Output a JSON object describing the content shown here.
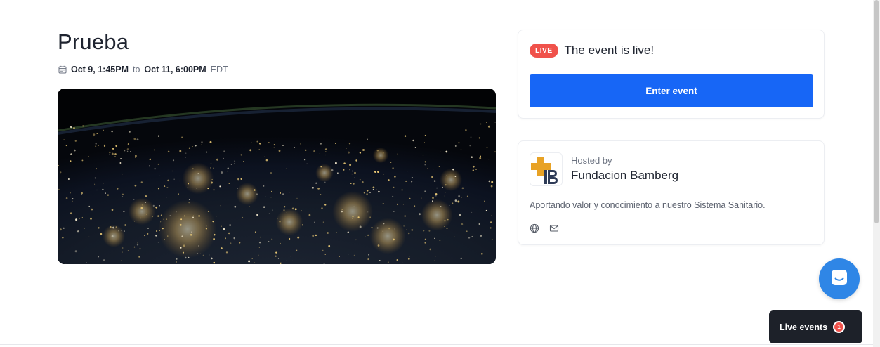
{
  "event": {
    "title": "Prueba",
    "start": "Oct 9, 1:45PM",
    "to": "to",
    "end": "Oct 11, 6:00PM",
    "timezone": "EDT",
    "image_alt": "Earth at night from space"
  },
  "live_card": {
    "badge": "LIVE",
    "status_text": "The event is live!",
    "enter_label": "Enter event",
    "badge_color": "#f0524b",
    "button_color": "#1766f6"
  },
  "host": {
    "hosted_by": "Hosted by",
    "name": "Fundacion Bamberg",
    "description": "Aportando valor y conocimiento a nuestro Sistema Sanitario.",
    "icons": [
      "globe-icon",
      "mail-icon"
    ]
  },
  "widgets": {
    "live_events_label": "Live events",
    "live_events_count": "1",
    "chat_icon": "chat-icon"
  }
}
